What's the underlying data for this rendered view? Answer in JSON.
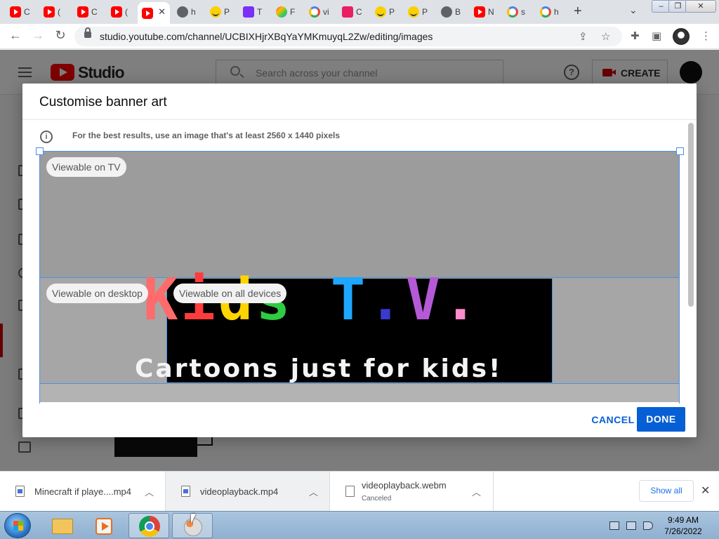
{
  "browser": {
    "tabs": [
      {
        "icon": "youtube-icon",
        "label": "C",
        "active": false
      },
      {
        "icon": "youtube-icon",
        "label": "(",
        "active": false
      },
      {
        "icon": "youtube-icon",
        "label": "C",
        "active": false
      },
      {
        "icon": "youtube-icon",
        "label": "(",
        "active": false
      },
      {
        "icon": "youtube-icon",
        "label": "",
        "active": true
      },
      {
        "icon": "globe-icon",
        "label": "h",
        "active": false
      },
      {
        "icon": "smiley-icon",
        "label": "P",
        "active": false
      },
      {
        "icon": "tt-icon",
        "label": "T",
        "active": false
      },
      {
        "icon": "rainbow-icon",
        "label": "F",
        "active": false
      },
      {
        "icon": "google-icon",
        "label": "vi",
        "active": false
      },
      {
        "icon": "pink-heart-icon",
        "label": "C",
        "active": false
      },
      {
        "icon": "smiley-icon",
        "label": "P",
        "active": false
      },
      {
        "icon": "smiley-icon",
        "label": "P",
        "active": false
      },
      {
        "icon": "globe-icon",
        "label": "B",
        "active": false
      },
      {
        "icon": "youtube-icon",
        "label": "N",
        "active": false
      },
      {
        "icon": "google-icon",
        "label": "s",
        "active": false
      },
      {
        "icon": "google-icon",
        "label": "h",
        "active": false
      }
    ],
    "new_tab_label": "+",
    "url": "studio.youtube.com/channel/UCBIXHjrXBqYaYMKmuyqL2Zw/editing/images"
  },
  "studio": {
    "brand": "Studio",
    "search_placeholder": "Search across your channel",
    "create_label": "CREATE"
  },
  "dialog": {
    "title": "Customise banner art",
    "info_text": "For the best results, use an image that's at least 2560 x 1440 pixels",
    "zones": {
      "tv": "Viewable on TV",
      "desktop": "Viewable on desktop",
      "all_devices": "Viewable on all devices"
    },
    "banner_title_letters": [
      "K",
      "i",
      "d",
      "s",
      " ",
      "T",
      ".",
      "V",
      "."
    ],
    "banner_letter_colors": [
      "#ff6b6b",
      "#ff3b3b",
      "#ffd400",
      "#2ecc40",
      "#ffffff",
      "#1ea7ff",
      "#3a3acc",
      "#b45ad6",
      "#ff8ccc"
    ],
    "banner_subtitle": "Cartoons just for kids!",
    "cancel_label": "CANCEL",
    "done_label": "DONE"
  },
  "downloads": {
    "items": [
      {
        "name": "Minecraft if playe....mp4",
        "status": ""
      },
      {
        "name": "videoplayback.mp4",
        "status": ""
      },
      {
        "name": "videoplayback.webm",
        "status": "Canceled"
      }
    ],
    "show_all_label": "Show all"
  },
  "taskbar": {
    "time": "9:49 AM",
    "date": "7/26/2022"
  }
}
